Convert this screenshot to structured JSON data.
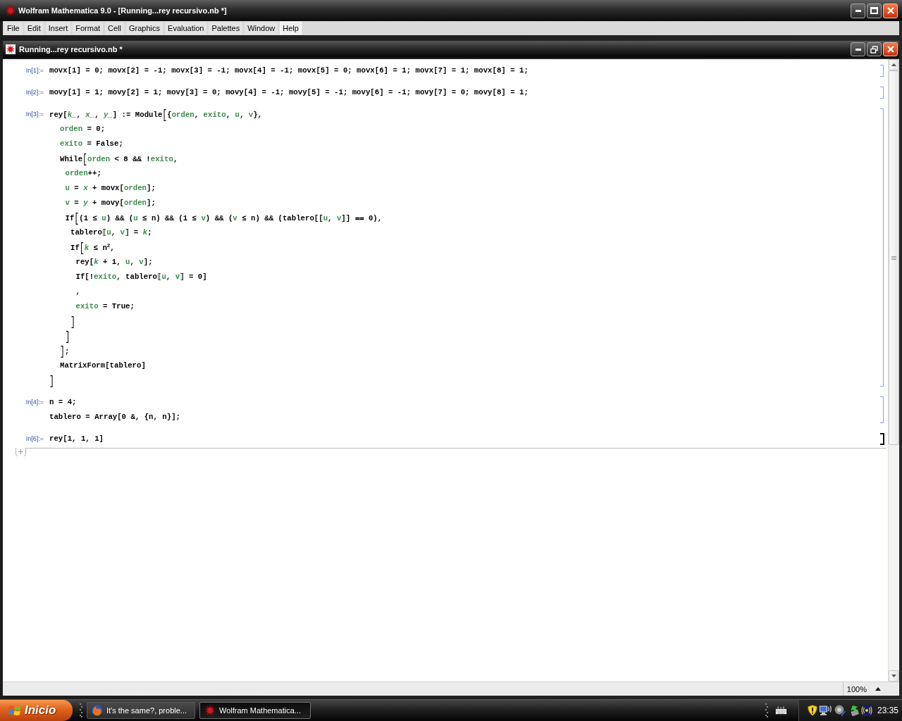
{
  "window": {
    "title": "Wolfram Mathematica 9.0 - [Running...rey recursivo.nb *]"
  },
  "menu_bar": [
    {
      "label": "File",
      "selected": false
    },
    {
      "label": "Edit",
      "selected": false
    },
    {
      "label": "Insert",
      "selected": false
    },
    {
      "label": "Format",
      "selected": false
    },
    {
      "label": "Cell",
      "selected": false
    },
    {
      "label": "Graphics",
      "selected": false
    },
    {
      "label": "Evaluation",
      "selected": false
    },
    {
      "label": "Palettes",
      "selected": false
    },
    {
      "label": "Window",
      "selected": false
    },
    {
      "label": "Help",
      "selected": true
    }
  ],
  "document": {
    "title": "Running...rey recursivo.nb *",
    "cells": [
      {
        "label": "In[1]:=",
        "evaluating": false,
        "lines": [
          {
            "tokens": [
              {
                "kind": "plain",
                "text": "movx[1] = 0; movx[2] = -1; movx[3] = -1; movx[4] = -1; movx[5] = 0; movx[6] = 1; movx[7] = 1; movx[8] = 1;"
              }
            ]
          }
        ]
      },
      {
        "label": "In[2]:=",
        "evaluating": false,
        "lines": [
          {
            "tokens": [
              {
                "kind": "plain",
                "text": "movy[1] = 1; movy[2] = 1; movy[3] = 0; movy[4] = -1; movy[5] = -1; movy[6] = -1; movy[7] = 0; movy[8] = 1;"
              }
            ]
          }
        ]
      },
      {
        "label": "In[3]:=",
        "evaluating": false,
        "lines": [
          {
            "tokens": [
              {
                "kind": "plain",
                "text": "rey["
              },
              {
                "kind": "pattern",
                "text": "k_"
              },
              {
                "kind": "plain",
                "text": ", "
              },
              {
                "kind": "pattern",
                "text": "x_"
              },
              {
                "kind": "plain",
                "text": ", "
              },
              {
                "kind": "pattern",
                "text": "y_"
              },
              {
                "kind": "plain",
                "text": "] := Module"
              },
              {
                "kind": "bracket",
                "text": "["
              },
              {
                "kind": "plain",
                "text": "{"
              },
              {
                "kind": "local",
                "text": "orden"
              },
              {
                "kind": "plain",
                "text": ", "
              },
              {
                "kind": "local",
                "text": "exito"
              },
              {
                "kind": "plain",
                "text": ", "
              },
              {
                "kind": "local",
                "text": "u"
              },
              {
                "kind": "plain",
                "text": ", "
              },
              {
                "kind": "local",
                "text": "v"
              },
              {
                "kind": "plain",
                "text": "},"
              }
            ],
            "children": [
              {
                "tokens": [
                  {
                    "kind": "local",
                    "text": "orden"
                  },
                  {
                    "kind": "plain",
                    "text": " = 0;"
                  }
                ]
              },
              {
                "tokens": [
                  {
                    "kind": "local",
                    "text": "exito"
                  },
                  {
                    "kind": "plain",
                    "text": " = False;"
                  }
                ]
              },
              {
                "tokens": [
                  {
                    "kind": "plain",
                    "text": "While"
                  },
                  {
                    "kind": "bracket",
                    "text": "["
                  },
                  {
                    "kind": "local",
                    "text": "orden"
                  },
                  {
                    "kind": "plain",
                    "text": " < 8 && !"
                  },
                  {
                    "kind": "local",
                    "text": "exito"
                  },
                  {
                    "kind": "plain",
                    "text": ","
                  }
                ],
                "children": [
                  {
                    "tokens": [
                      {
                        "kind": "local",
                        "text": "orden"
                      },
                      {
                        "kind": "plain",
                        "text": "++;"
                      }
                    ]
                  },
                  {
                    "tokens": [
                      {
                        "kind": "local",
                        "text": "u"
                      },
                      {
                        "kind": "plain",
                        "text": " = "
                      },
                      {
                        "kind": "pattern",
                        "text": "x"
                      },
                      {
                        "kind": "plain",
                        "text": " + movx["
                      },
                      {
                        "kind": "local",
                        "text": "orden"
                      },
                      {
                        "kind": "plain",
                        "text": "];"
                      }
                    ]
                  },
                  {
                    "tokens": [
                      {
                        "kind": "local",
                        "text": "v"
                      },
                      {
                        "kind": "plain",
                        "text": " = "
                      },
                      {
                        "kind": "pattern",
                        "text": "y"
                      },
                      {
                        "kind": "plain",
                        "text": " + movy["
                      },
                      {
                        "kind": "local",
                        "text": "orden"
                      },
                      {
                        "kind": "plain",
                        "text": "];"
                      }
                    ]
                  },
                  {
                    "tokens": [
                      {
                        "kind": "plain",
                        "text": "If"
                      },
                      {
                        "kind": "bracket",
                        "text": "["
                      },
                      {
                        "kind": "plain",
                        "text": "(1 ≤ "
                      },
                      {
                        "kind": "local",
                        "text": "u"
                      },
                      {
                        "kind": "plain",
                        "text": ") && ("
                      },
                      {
                        "kind": "local",
                        "text": "u"
                      },
                      {
                        "kind": "plain",
                        "text": " ≤ n) && (1 ≤ "
                      },
                      {
                        "kind": "local",
                        "text": "v"
                      },
                      {
                        "kind": "plain",
                        "text": ") && ("
                      },
                      {
                        "kind": "local",
                        "text": "v"
                      },
                      {
                        "kind": "plain",
                        "text": " ≤ n) && (tablero[["
                      },
                      {
                        "kind": "local",
                        "text": "u"
                      },
                      {
                        "kind": "plain",
                        "text": ", "
                      },
                      {
                        "kind": "local",
                        "text": "v"
                      },
                      {
                        "kind": "plain",
                        "text": "]] ⩵ 0),"
                      }
                    ],
                    "children": [
                      {
                        "tokens": [
                          {
                            "kind": "plain",
                            "text": "tablero⟦"
                          },
                          {
                            "kind": "local",
                            "text": "u"
                          },
                          {
                            "kind": "plain",
                            "text": ", "
                          },
                          {
                            "kind": "local",
                            "text": "v"
                          },
                          {
                            "kind": "plain",
                            "text": "⟧ = "
                          },
                          {
                            "kind": "pattern",
                            "text": "k"
                          },
                          {
                            "kind": "plain",
                            "text": ";"
                          }
                        ]
                      },
                      {
                        "tokens": [
                          {
                            "kind": "plain",
                            "text": "If"
                          },
                          {
                            "kind": "bracket",
                            "text": "["
                          },
                          {
                            "kind": "pattern",
                            "text": "k"
                          },
                          {
                            "kind": "plain",
                            "text": " ≤ n$^{2}$,"
                          }
                        ],
                        "children": [
                          {
                            "tokens": [
                              {
                                "kind": "plain",
                                "text": "rey["
                              },
                              {
                                "kind": "pattern",
                                "text": "k"
                              },
                              {
                                "kind": "plain",
                                "text": " + 1, "
                              },
                              {
                                "kind": "local",
                                "text": "u"
                              },
                              {
                                "kind": "plain",
                                "text": ", "
                              },
                              {
                                "kind": "local",
                                "text": "v"
                              },
                              {
                                "kind": "plain",
                                "text": "];"
                              }
                            ]
                          },
                          {
                            "tokens": [
                              {
                                "kind": "plain",
                                "text": "If[!"
                              },
                              {
                                "kind": "local",
                                "text": "exito"
                              },
                              {
                                "kind": "plain",
                                "text": ", tablero⟦"
                              },
                              {
                                "kind": "local",
                                "text": "u"
                              },
                              {
                                "kind": "plain",
                                "text": ", "
                              },
                              {
                                "kind": "local",
                                "text": "v"
                              },
                              {
                                "kind": "plain",
                                "text": "⟧ = 0]"
                              }
                            ]
                          },
                          {
                            "tokens": [
                              {
                                "kind": "plain",
                                "text": ","
                              }
                            ]
                          },
                          {
                            "tokens": [
                              {
                                "kind": "local",
                                "text": "exito"
                              },
                              {
                                "kind": "plain",
                                "text": " = True;"
                              }
                            ]
                          }
                        ]
                      },
                      {
                        "tokens": [
                          {
                            "kind": "bracket",
                            "text": "]"
                          }
                        ]
                      }
                    ]
                  },
                  {
                    "tokens": [
                      {
                        "kind": "bracket",
                        "text": "]"
                      }
                    ]
                  }
                ]
              },
              {
                "tokens": [
                  {
                    "kind": "bracket",
                    "text": "]"
                  },
                  {
                    "kind": "plain",
                    "text": ";"
                  }
                ]
              },
              {
                "tokens": [
                  {
                    "kind": "plain",
                    "text": "MatrixForm[tablero]"
                  }
                ]
              }
            ]
          },
          {
            "tokens": [
              {
                "kind": "bracket",
                "text": "]"
              }
            ]
          }
        ]
      },
      {
        "label": "In[4]:=",
        "evaluating": false,
        "lines": [
          {
            "tokens": [
              {
                "kind": "plain",
                "text": "n = 4;"
              }
            ]
          },
          {
            "tokens": [
              {
                "kind": "plain",
                "text": "tablero = Array[0 &, {n, n}];"
              }
            ]
          }
        ]
      },
      {
        "label": "In[6]:=",
        "evaluating": true,
        "lines": [
          {
            "tokens": [
              {
                "kind": "plain",
                "text": "rey[1, 1, 1]"
              }
            ]
          }
        ]
      }
    ]
  },
  "status_bar": {
    "zoom": "100%"
  },
  "taskbar": {
    "start_button": "Inicio",
    "tasks": [
      {
        "kind": "browser",
        "label": "It's the same?, proble...",
        "selected": false
      },
      {
        "kind": "app",
        "label": "Wolfram Mathematica...",
        "selected": true
      }
    ],
    "clock": "23:35"
  }
}
